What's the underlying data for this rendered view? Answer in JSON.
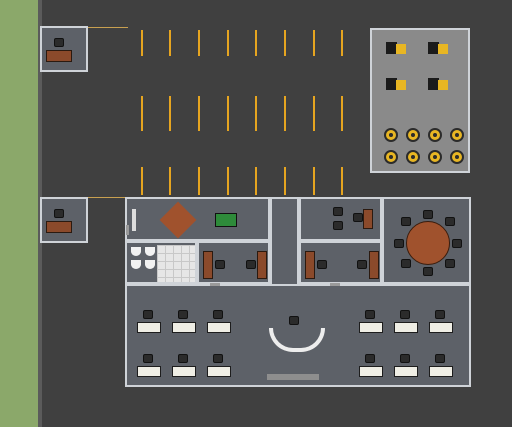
{
  "map": {
    "type": "top-down office building battle map",
    "signature_text": "",
    "colors": {
      "asphalt": "#404040",
      "grass": "#8ba86a",
      "parking_line": "#e6a520",
      "floor": "#5d6168",
      "wall": "#cfd3d8",
      "desk_wood": "#8b4a2b",
      "conference_table": "#a0522d",
      "generator_accent": "#e8b623"
    },
    "icons": [
      "desk-icon",
      "chair-icon",
      "generator-icon",
      "fan-icon",
      "toilet-icon",
      "table-icon",
      "workstation-icon"
    ]
  }
}
